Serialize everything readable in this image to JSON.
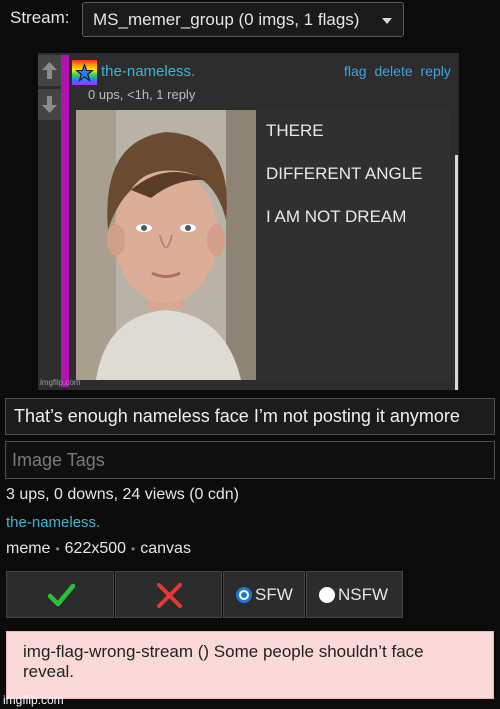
{
  "stream": {
    "label": "Stream:",
    "selected": "MS_memer_group (0 imgs, 1 flags)"
  },
  "post": {
    "username": "the-nameless.",
    "meta": "0 ups, <1h, 1 reply",
    "actions": [
      "flag",
      "delete",
      "reply"
    ],
    "meme_lines": [
      "THERE",
      "DIFFERENT ANGLE",
      "I AM NOT DREAM"
    ],
    "watermark": "imgflip.com"
  },
  "title_value": "That’s enough nameless face I’m not posting it anymore",
  "tags_placeholder": "Image Tags",
  "stats": "3 ups, 0 downs, 24 views (0 cdn)",
  "author": "the-nameless.",
  "info": {
    "type": "meme",
    "dimensions": "622x500",
    "format": "canvas"
  },
  "moderation": {
    "sfw_label": "SFW",
    "nsfw_label": "NSFW",
    "selected": "SFW"
  },
  "flag_message": "img-flag-wrong-stream () Some people shouldn’t face reveal.",
  "footer_watermark": "imgflip.com",
  "colors": {
    "accent_link": "#41b4d2",
    "action_link": "#3fa3e0",
    "comment_bar": "#b112b4",
    "approve": "#27c13a",
    "reject": "#e03a3a",
    "flag_bg": "#fbd9d9"
  }
}
